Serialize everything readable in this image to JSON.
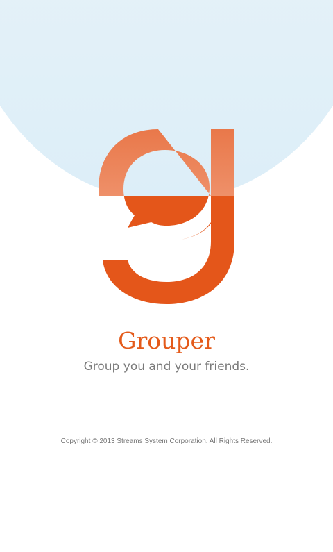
{
  "splash": {
    "logo_icon": "grouper-g-speech-bubble-icon",
    "app_name": "Grouper",
    "tagline": "Group you and your friends.",
    "copyright": "Copyright © 2013 Streams System Corporation. All Rights Reserved."
  },
  "colors": {
    "brand_orange": "#e45a1a",
    "brand_orange_light": "#ec8456",
    "sky_blue": "#e4f1f8",
    "text_gray": "#7a7a7a"
  }
}
